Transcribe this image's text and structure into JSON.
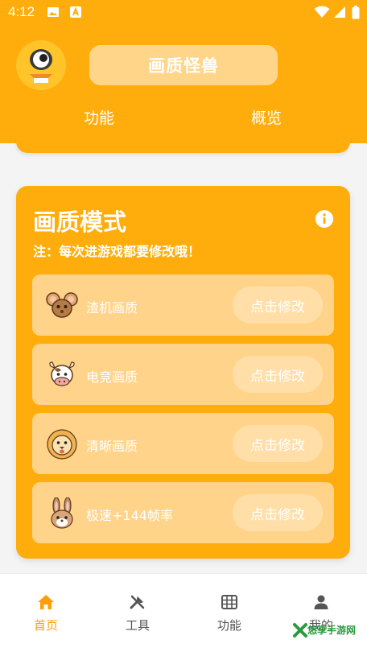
{
  "status_bar": {
    "time": "4:12"
  },
  "header": {
    "title": "画质怪兽",
    "tabs": [
      {
        "label": "功能"
      },
      {
        "label": "概览"
      }
    ]
  },
  "quality_mode": {
    "title": "画质模式",
    "note": "注：每次进游戏都要修改哦！",
    "rows": [
      {
        "label": "渣机画质",
        "button": "点击修改",
        "mascot": "mouse-icon"
      },
      {
        "label": "电竞画质",
        "button": "点击修改",
        "mascot": "cow-icon"
      },
      {
        "label": "清晰画质",
        "button": "点击修改",
        "mascot": "lion-icon"
      },
      {
        "label": "极速+144帧率",
        "button": "点击修改",
        "mascot": "rabbit-icon"
      }
    ]
  },
  "bottom_nav": [
    {
      "label": "首页",
      "icon": "home-icon",
      "active": true
    },
    {
      "label": "工具",
      "icon": "tools-icon",
      "active": false
    },
    {
      "label": "功能",
      "icon": "grid-icon",
      "active": false
    },
    {
      "label": "我的",
      "icon": "user-icon",
      "active": false
    }
  ],
  "watermark": {
    "text": "悠享手游网"
  },
  "colors": {
    "accent": "#ffad0d",
    "row_bg": "#ffd38a",
    "active_nav": "#ff9e0a"
  }
}
